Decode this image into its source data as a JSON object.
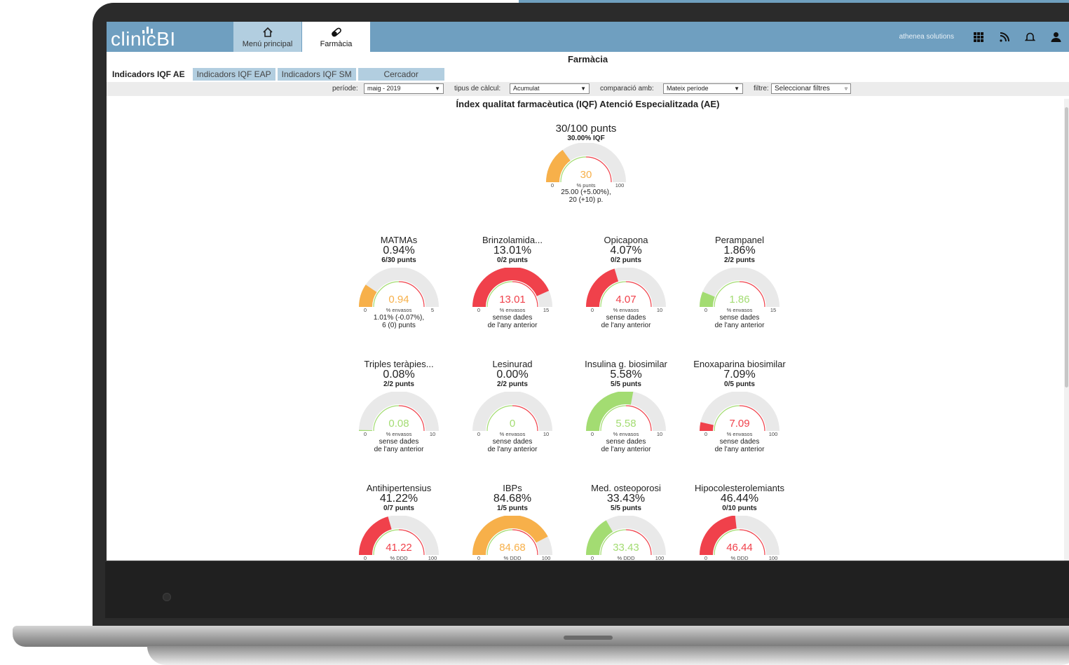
{
  "app": {
    "logo_text": "clinicBI",
    "nav": [
      {
        "label": "Menú principal",
        "icon": "home-icon"
      },
      {
        "label": "Farmàcia",
        "icon": "pill-icon"
      }
    ],
    "user": "athenea solutions",
    "top_icons": [
      "apps-grid-icon",
      "rss-feed-icon",
      "bell-icon",
      "user-icon"
    ]
  },
  "page_title": "Farmàcia",
  "subtabs": [
    "Indicadors IQF AE",
    "Indicadors IQF EAP",
    "Indicadors IQF SM",
    "Cercador"
  ],
  "filters": {
    "periode_label": "període:",
    "periode_value": "maig - 2019",
    "calcul_label": "tipus de càlcul:",
    "calcul_value": "Acumulat",
    "comparacio_label": "comparació amb:",
    "comparacio_value": "Mateix període",
    "filtre_label": "filtre:",
    "filtre_value": "Seleccionar filtres"
  },
  "main_title": "Índex qualitat farmacèutica (IQF) Atenció Especialitzada (AE)",
  "summary": {
    "title": "30/100 punts",
    "subtitle": "30.00% IQF",
    "value": 30,
    "display": "30",
    "unit": "% punts",
    "min": "0",
    "max": "100",
    "fraction": 0.3,
    "color": "#f7b04a",
    "foot1": "25.00 (+5.00%),",
    "foot2": "20 (+10) p."
  },
  "indicators": [
    {
      "name": "MATMAs",
      "percent": "0.94%",
      "points": "6/30 punts",
      "display": "0.94",
      "unit": "% envasos",
      "min": "0",
      "max": "5",
      "fraction": 0.188,
      "color": "#f7b04a",
      "foot1": "1.01% (-0.07%),",
      "foot2": "6 (0) punts"
    },
    {
      "name": "Brinzolamida...",
      "percent": "13.01%",
      "points": "0/2 punts",
      "display": "13.01",
      "unit": "% envasos",
      "min": "0",
      "max": "15",
      "fraction": 0.867,
      "color": "#f0414b",
      "foot1": "sense dades",
      "foot2": "de l'any anterior"
    },
    {
      "name": "Opicapona",
      "percent": "4.07%",
      "points": "0/2 punts",
      "display": "4.07",
      "unit": "% envasos",
      "min": "0",
      "max": "10",
      "fraction": 0.407,
      "color": "#f0414b",
      "foot1": "sense dades",
      "foot2": "de l'any anterior"
    },
    {
      "name": "Perampanel",
      "percent": "1.86%",
      "points": "2/2 punts",
      "display": "1.86",
      "unit": "% envasos",
      "min": "0",
      "max": "15",
      "fraction": 0.124,
      "color": "#a3dc72",
      "foot1": "sense dades",
      "foot2": "de l'any anterior"
    },
    {
      "name": "Triples teràpies...",
      "percent": "0.08%",
      "points": "2/2 punts",
      "display": "0.08",
      "unit": "% envasos",
      "min": "0",
      "max": "10",
      "fraction": 0.008,
      "color": "#a3dc72",
      "foot1": "sense dades",
      "foot2": "de l'any anterior"
    },
    {
      "name": "Lesinurad",
      "percent": "0.00%",
      "points": "2/2 punts",
      "display": "0",
      "unit": "% envasos",
      "min": "0",
      "max": "10",
      "fraction": 0.0,
      "color": "#a3dc72",
      "foot1": "sense dades",
      "foot2": "de l'any anterior"
    },
    {
      "name": "Insulina g. biosimilar",
      "percent": "5.58%",
      "points": "5/5 punts",
      "display": "5.58",
      "unit": "% envasos",
      "min": "0",
      "max": "10",
      "fraction": 0.558,
      "color": "#a3dc72",
      "foot1": "sense dades",
      "foot2": "de l'any anterior"
    },
    {
      "name": "Enoxaparina biosimilar",
      "percent": "7.09%",
      "points": "0/5 punts",
      "display": "7.09",
      "unit": "% envasos",
      "min": "0",
      "max": "100",
      "fraction": 0.0709,
      "color": "#f0414b",
      "foot1": "sense dades",
      "foot2": "de l'any anterior"
    },
    {
      "name": "Antihipertensius",
      "percent": "41.22%",
      "points": "0/7 punts",
      "display": "41.22",
      "unit": "% DDD",
      "min": "0",
      "max": "100",
      "fraction": 0.4122,
      "color": "#f0414b",
      "foot1": "",
      "foot2": ""
    },
    {
      "name": "IBPs",
      "percent": "84.68%",
      "points": "1/5 punts",
      "display": "84.68",
      "unit": "% DDD",
      "min": "0",
      "max": "100",
      "fraction": 0.8468,
      "color": "#f7b04a",
      "foot1": "",
      "foot2": ""
    },
    {
      "name": "Med. osteoporosi",
      "percent": "33.43%",
      "points": "5/5 punts",
      "display": "33.43",
      "unit": "% DDD",
      "min": "0",
      "max": "100",
      "fraction": 0.3343,
      "color": "#a3dc72",
      "foot1": "",
      "foot2": ""
    },
    {
      "name": "Hipocolesterolemiants",
      "percent": "46.44%",
      "points": "0/10 punts",
      "display": "46.44",
      "unit": "% DDD",
      "min": "0",
      "max": "100",
      "fraction": 0.4644,
      "color": "#f0414b",
      "foot1": "",
      "foot2": ""
    }
  ]
}
